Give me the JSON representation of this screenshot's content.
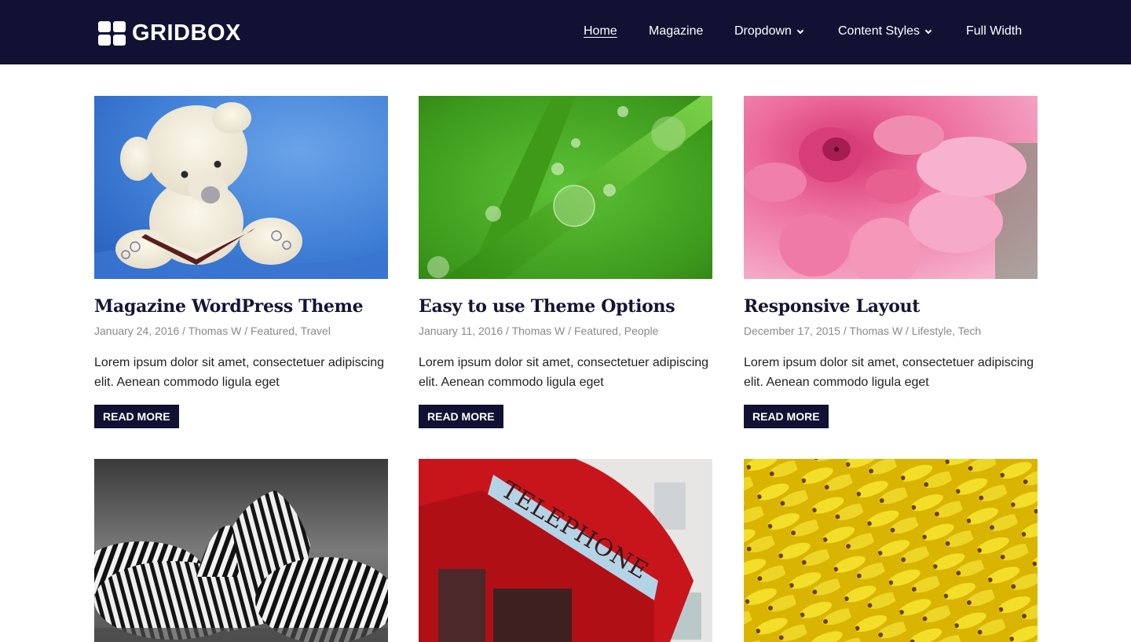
{
  "header": {
    "logo_text": "GRIDBOX",
    "logo_icon": "grid-four-squares",
    "background_color": "#111133",
    "nav": [
      {
        "label": "Home",
        "active": true,
        "has_dropdown": false
      },
      {
        "label": "Magazine",
        "active": false,
        "has_dropdown": false
      },
      {
        "label": "Dropdown",
        "active": false,
        "has_dropdown": true,
        "icon": "chevron-down"
      },
      {
        "label": "Content Styles",
        "active": false,
        "has_dropdown": true,
        "icon": "chevron-down"
      },
      {
        "label": "Full Width",
        "active": false,
        "has_dropdown": false
      }
    ]
  },
  "posts": [
    {
      "image": "teddy-bear-reading-book-on-blue",
      "title": "Magazine WordPress Theme",
      "date": "January 24, 2016",
      "author": "Thomas W",
      "categories": [
        "Featured",
        "Travel"
      ],
      "excerpt": "Lorem ipsum dolor sit amet, consectetuer adipiscing elit. Aenean commodo ligula eget",
      "button": "READ MORE"
    },
    {
      "image": "grass-blade-water-drops",
      "title": "Easy to use Theme Options",
      "date": "January 11, 2016",
      "author": "Thomas W",
      "categories": [
        "Featured",
        "People"
      ],
      "excerpt": "Lorem ipsum dolor sit amet, consectetuer adipiscing elit. Aenean commodo ligula eget",
      "button": "READ MORE"
    },
    {
      "image": "pink-dahlia-flower",
      "title": "Responsive Layout",
      "date": "December 17, 2015",
      "author": "Thomas W",
      "categories": [
        "Lifestyle",
        "Tech"
      ],
      "excerpt": "Lorem ipsum dolor sit amet, consectetuer adipiscing elit. Aenean commodo ligula eget",
      "button": "READ MORE"
    },
    {
      "image": "zebras-black-and-white"
    },
    {
      "image": "red-telephone-box",
      "image_text": "TELEPHONE"
    },
    {
      "image": "pile-of-bananas"
    }
  ],
  "meta_separator": " / ",
  "category_separator": ", "
}
